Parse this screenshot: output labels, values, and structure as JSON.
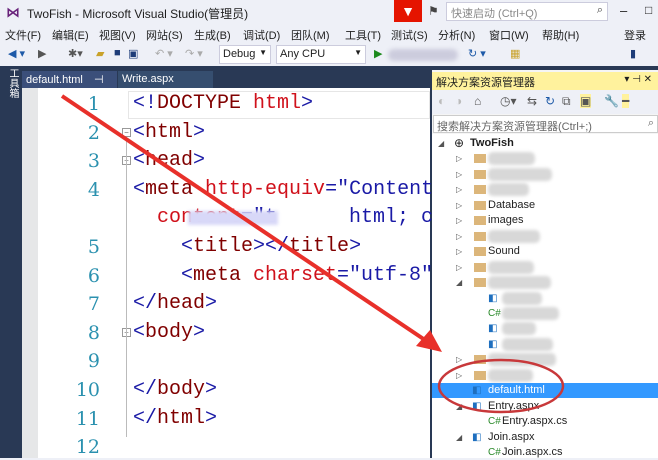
{
  "window": {
    "title": "TwoFish - Microsoft Visual Studio(管理员)",
    "quick_launch_placeholder": "快速启动 (Ctrl+Q)",
    "sign_in": "登录"
  },
  "menu": [
    "文件(F)",
    "编辑(E)",
    "视图(V)",
    "网站(S)",
    "生成(B)",
    "调试(D)",
    "团队(M)",
    "工具(T)",
    "测试(S)",
    "分析(N)",
    "窗口(W)",
    "帮助(H)"
  ],
  "toolbar": {
    "config": "Debug",
    "platform": "Any CPU"
  },
  "left_tab": "工具箱",
  "tabs": [
    {
      "label": "default.html",
      "active": true
    },
    {
      "label": "Write.aspx",
      "active": false
    }
  ],
  "editor": {
    "lines": [
      {
        "n": "1",
        "tokens": [
          [
            "b",
            "<!"
          ],
          [
            "m",
            "DOCTYPE "
          ],
          [
            "r",
            "html"
          ],
          [
            "b",
            ">"
          ]
        ]
      },
      {
        "n": "2",
        "tokens": [
          [
            "b",
            "<"
          ],
          [
            "m",
            "html"
          ],
          [
            "b",
            ">"
          ]
        ]
      },
      {
        "n": "3",
        "tokens": [
          [
            "b",
            "<"
          ],
          [
            "m",
            "head"
          ],
          [
            "b",
            ">"
          ]
        ]
      },
      {
        "n": "4",
        "tokens": [
          [
            "b",
            "<"
          ],
          [
            "m",
            "meta "
          ],
          [
            "r",
            "http-equiv"
          ],
          [
            "b",
            "=\"Content"
          ]
        ]
      },
      {
        "n": "",
        "tokens": [
          [
            "r",
            "  content"
          ],
          [
            "b",
            "=\"t      html; cha"
          ]
        ]
      },
      {
        "n": "5",
        "tokens": [
          [
            "b",
            "    <"
          ],
          [
            "m",
            "title"
          ],
          [
            "b",
            "></"
          ],
          [
            "m",
            "title"
          ],
          [
            "b",
            ">"
          ]
        ]
      },
      {
        "n": "6",
        "tokens": [
          [
            "b",
            "    <"
          ],
          [
            "m",
            "meta "
          ],
          [
            "r",
            "charset"
          ],
          [
            "b",
            "=\"utf-8\""
          ]
        ]
      },
      {
        "n": "7",
        "tokens": [
          [
            "b",
            "</"
          ],
          [
            "m",
            "head"
          ],
          [
            "b",
            ">"
          ]
        ]
      },
      {
        "n": "8",
        "tokens": [
          [
            "b",
            "<"
          ],
          [
            "m",
            "body"
          ],
          [
            "b",
            ">"
          ]
        ]
      },
      {
        "n": "9",
        "tokens": []
      },
      {
        "n": "10",
        "tokens": [
          [
            "b",
            "</"
          ],
          [
            "m",
            "body"
          ],
          [
            "b",
            ">"
          ]
        ]
      },
      {
        "n": "11",
        "tokens": [
          [
            "b",
            "</"
          ],
          [
            "m",
            "html"
          ],
          [
            "b",
            ">"
          ]
        ]
      },
      {
        "n": "12",
        "tokens": []
      }
    ]
  },
  "solution_explorer": {
    "title": "解决方案资源管理器",
    "search_placeholder": "搜索解决方案资源管理器(Ctrl+;)",
    "items": [
      {
        "label": "TwoFish",
        "level": 0,
        "type": "project",
        "expanded": true
      },
      {
        "label": "",
        "level": 1,
        "type": "folder"
      },
      {
        "label": "",
        "level": 1,
        "type": "folder"
      },
      {
        "label": "",
        "level": 1,
        "type": "folder"
      },
      {
        "label": "Database",
        "level": 1,
        "type": "folder"
      },
      {
        "label": "images",
        "level": 1,
        "type": "folder"
      },
      {
        "label": "",
        "level": 1,
        "type": "folder"
      },
      {
        "label": "Sound",
        "level": 1,
        "type": "folder"
      },
      {
        "label": "",
        "level": 1,
        "type": "folder"
      },
      {
        "label": "",
        "level": 1,
        "type": "folder-open",
        "expanded": true
      },
      {
        "label": "",
        "level": 2,
        "type": "file"
      },
      {
        "label": "",
        "level": 2,
        "type": "cs"
      },
      {
        "label": "",
        "level": 2,
        "type": "file"
      },
      {
        "label": "",
        "level": 2,
        "type": "file"
      },
      {
        "label": "",
        "level": 1,
        "type": "folder"
      },
      {
        "label": "",
        "level": 1,
        "type": "folder"
      },
      {
        "label": "default.html",
        "level": 1,
        "type": "html",
        "selected": true
      },
      {
        "label": "Entry.aspx",
        "level": 1,
        "type": "aspx",
        "expanded": true
      },
      {
        "label": "Entry.aspx.cs",
        "level": 2,
        "type": "cs"
      },
      {
        "label": "Join.aspx",
        "level": 1,
        "type": "aspx",
        "expanded": true
      },
      {
        "label": "Join.aspx.cs",
        "level": 2,
        "type": "cs"
      }
    ]
  },
  "colors": {
    "accent": "#3399ff",
    "annotation": "#e8302a",
    "panel_header": "#fff29d",
    "chrome": "#293955"
  }
}
